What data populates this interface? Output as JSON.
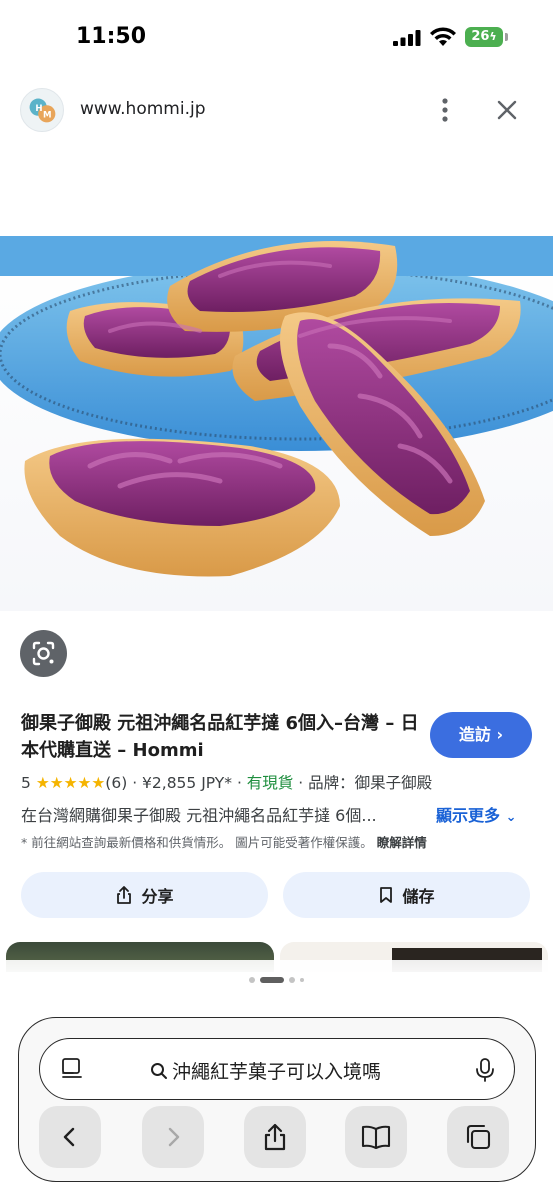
{
  "status_bar": {
    "time": "11:50",
    "battery": "26"
  },
  "site": {
    "url": "www.hommi.jp"
  },
  "product": {
    "title": "御果子御殿 元祖沖繩名品紅芋撻 6個入–台灣 – 日本代購直送 – Hommi",
    "visit_label": "造訪",
    "rating": "5",
    "stars": "★★★★★",
    "review_count": "(6)",
    "price": "¥2,855 JPY*",
    "stock": "有現貨",
    "brand": "品牌：御果子御殿",
    "description": "在台灣網購御果子御殿 元祖沖繩名品紅芋撻 6個...",
    "show_more": "顯示更多",
    "disclaimer": "* 前往網站查詢最新價格和供貨情形。 圖片可能受著作權保護。",
    "details_link": "瞭解詳情"
  },
  "actions": {
    "share_label": "分享",
    "save_label": "儲存"
  },
  "address_bar": {
    "query": "沖繩紅芋菓子可以入境嗎"
  },
  "colors": {
    "accent": "#3b6ee0",
    "stars": "#f5b400",
    "in_stock": "#1e8e3e",
    "pill_bg": "#eaf1fd",
    "battery": "#4caf50"
  },
  "icons": [
    "signal-icon",
    "wifi-icon",
    "more-vert-icon",
    "close-icon",
    "lens-icon",
    "share-icon",
    "bookmark-icon",
    "reader-icon",
    "search-icon",
    "mic-icon",
    "back-icon",
    "forward-icon",
    "book-icon",
    "tabs-icon"
  ]
}
